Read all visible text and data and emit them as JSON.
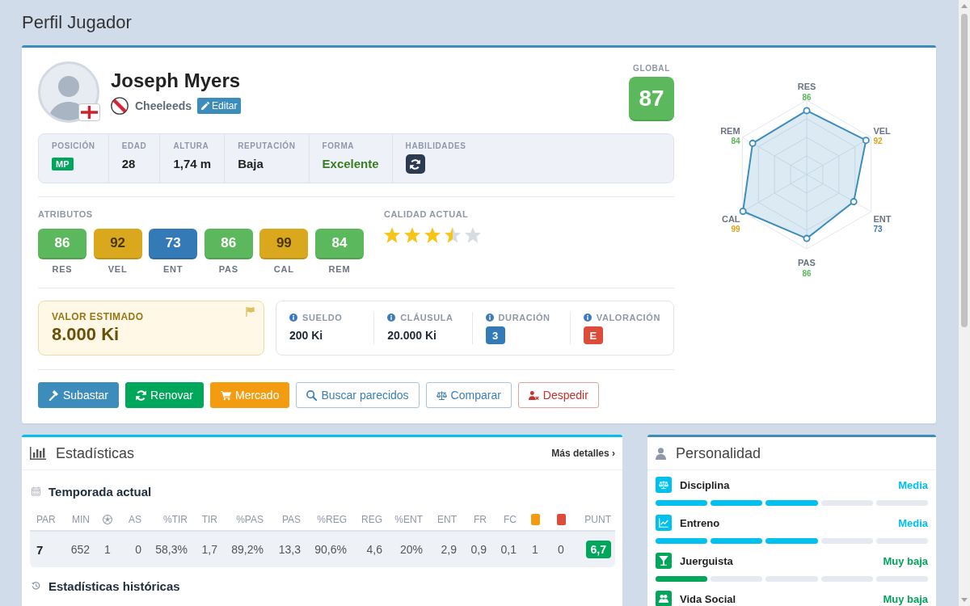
{
  "page": {
    "title": "Perfil Jugador"
  },
  "player": {
    "name": "Joseph Myers",
    "club": "Cheeleeds",
    "edit": "Editar",
    "global_label": "GLOBAL",
    "global": "87"
  },
  "info": [
    {
      "label": "POSICIÓN",
      "kind": "badge",
      "value": "MP",
      "color": "#00a65a"
    },
    {
      "label": "EDAD",
      "kind": "text",
      "value": "28"
    },
    {
      "label": "ALTURA",
      "kind": "text",
      "value": "1,74 m"
    },
    {
      "label": "REPUTACIÓN",
      "kind": "text",
      "value": "Baja"
    },
    {
      "label": "FORMA",
      "kind": "text",
      "value": "Excelente",
      "color": "#3b7d23"
    },
    {
      "label": "HABILIDADES",
      "kind": "icon"
    }
  ],
  "attributes": {
    "title": "ATRIBUTOS",
    "items": [
      {
        "label": "RES",
        "value": "86",
        "color": "#5cb85c"
      },
      {
        "label": "VEL",
        "value": "92",
        "color": "#d9a81c"
      },
      {
        "label": "ENT",
        "value": "73",
        "color": "#337ab7"
      },
      {
        "label": "PAS",
        "value": "86",
        "color": "#5cb85c"
      },
      {
        "label": "CAL",
        "value": "99",
        "color": "#d9a81c"
      },
      {
        "label": "REM",
        "value": "84",
        "color": "#5cb85c"
      }
    ]
  },
  "quality": {
    "title": "CALIDAD ACTUAL",
    "stars": 3.5
  },
  "estimated_value": {
    "label": "VALOR ESTIMADO",
    "value": "8.000 Ki"
  },
  "contract": [
    {
      "label": "SUELDO",
      "kind": "text",
      "value": "200 Ki"
    },
    {
      "label": "CLÁUSULA",
      "kind": "text",
      "value": "20.000 Ki"
    },
    {
      "label": "DURACIÓN",
      "kind": "badge",
      "value": "3",
      "color": "#337ab7"
    },
    {
      "label": "VALORACIÓN",
      "kind": "badge",
      "value": "E",
      "color": "#dd4b39"
    }
  ],
  "actions": [
    {
      "label": "Subastar",
      "kind": "solid",
      "color": "#3c8dbc"
    },
    {
      "label": "Renovar",
      "kind": "solid",
      "color": "#00a65a"
    },
    {
      "label": "Mercado",
      "kind": "solid",
      "color": "#f39c12"
    },
    {
      "label": "Buscar parecidos",
      "kind": "outline",
      "color": "#3c7fb5"
    },
    {
      "label": "Comparar",
      "kind": "outline",
      "color": "#3c7fb5"
    },
    {
      "label": "Despedir",
      "kind": "outline",
      "color": "#c9302c"
    }
  ],
  "radar": {
    "axes": [
      {
        "label": "RES",
        "value": "86",
        "color": "#5cb85c"
      },
      {
        "label": "VEL",
        "value": "92",
        "color": "#e0a21a"
      },
      {
        "label": "ENT",
        "value": "73",
        "color": "#337ab7"
      },
      {
        "label": "PAS",
        "value": "86",
        "color": "#5cb85c"
      },
      {
        "label": "CAL",
        "value": "99",
        "color": "#e0a21a"
      },
      {
        "label": "REM",
        "value": "84",
        "color": "#5cb85c"
      }
    ]
  },
  "statistics": {
    "title": "Estadísticas",
    "more_link": "Más detalles ›",
    "season_title": "Temporada actual",
    "columns": [
      {
        "kind": "text",
        "label": "PAR"
      },
      {
        "kind": "text",
        "label": "MIN"
      },
      {
        "kind": "icon"
      },
      {
        "kind": "text",
        "label": "AS"
      },
      {
        "kind": "text",
        "label": "%TIR"
      },
      {
        "kind": "text",
        "label": "TIR"
      },
      {
        "kind": "text",
        "label": "%PAS"
      },
      {
        "kind": "text",
        "label": "PAS"
      },
      {
        "kind": "text",
        "label": "%REG"
      },
      {
        "kind": "text",
        "label": "REG"
      },
      {
        "kind": "text",
        "label": "%ENT"
      },
      {
        "kind": "text",
        "label": "ENT"
      },
      {
        "kind": "text",
        "label": "FR"
      },
      {
        "kind": "text",
        "label": "FC"
      },
      {
        "kind": "swatch",
        "color": "#f39c12"
      },
      {
        "kind": "swatch",
        "color": "#dd4b39"
      },
      {
        "kind": "text",
        "label": "PUNT"
      }
    ],
    "rows": [
      {
        "cells": [
          "7",
          "652",
          "1",
          "0",
          "58,3%",
          "1,7",
          "89,2%",
          "13,3",
          "90,6%",
          "4,6",
          "20%",
          "2,9",
          "0,9",
          "0,1",
          "1",
          "0"
        ],
        "rating": "6,7"
      }
    ],
    "history_title": "Estadísticas históricas"
  },
  "personality": {
    "title": "Personalidad",
    "traits": [
      {
        "label": "Disciplina",
        "value": "Media",
        "level": 0.6,
        "color": "#00c0ef"
      },
      {
        "label": "Entreno",
        "value": "Media",
        "level": 0.6,
        "color": "#00c0ef"
      },
      {
        "label": "Juerguista",
        "value": "Muy baja",
        "level": 0.2,
        "color": "#00a65a"
      },
      {
        "label": "Vida Social",
        "value": "Muy baja",
        "color": "#00a65a"
      }
    ]
  }
}
